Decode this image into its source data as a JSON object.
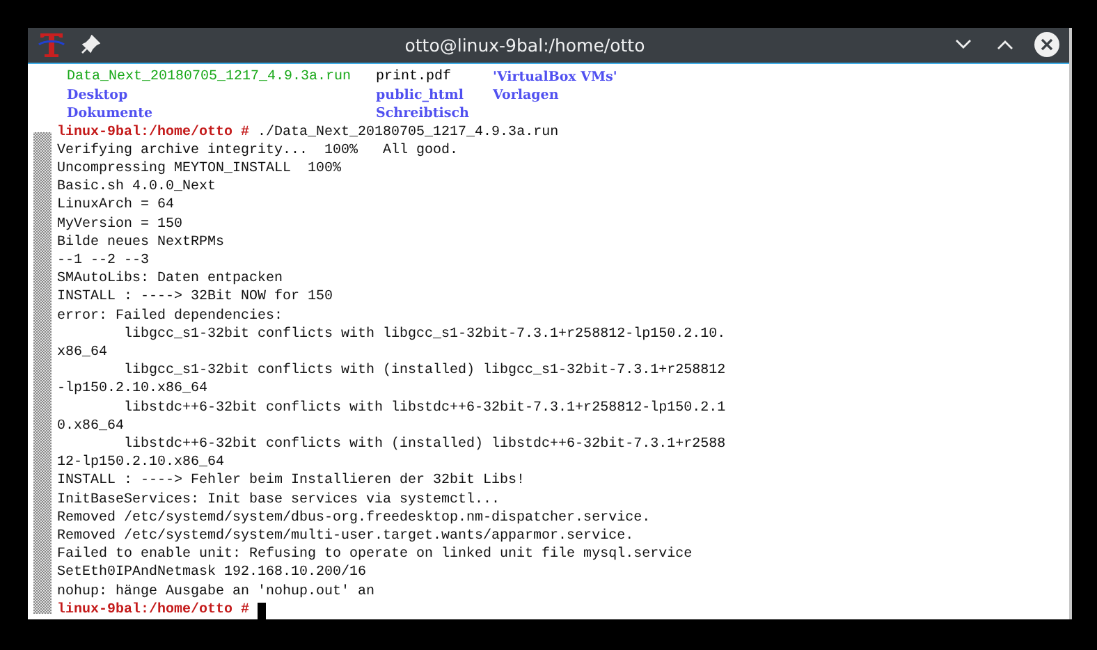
{
  "window": {
    "title": "otto@linux-9bal:/home/otto"
  },
  "listing": [
    [
      {
        "name": "Data_Next_20180705_1217_4.9.3a.run",
        "kind": "executable"
      },
      {
        "name": "print.pdf",
        "kind": "file"
      },
      {
        "name": "'VirtualBox VMs'",
        "kind": "directory"
      }
    ],
    [
      {
        "name": "Desktop",
        "kind": "directory"
      },
      {
        "name": "public_html",
        "kind": "directory"
      },
      {
        "name": "Vorlagen",
        "kind": "directory"
      }
    ],
    [
      {
        "name": "Dokumente",
        "kind": "directory"
      },
      {
        "name": "Schreibtisch",
        "kind": "directory"
      }
    ]
  ],
  "lines": [
    {
      "kind": "prompt",
      "prompt": "linux-9bal:/home/otto #",
      "command": "./Data_Next_20180705_1217_4.9.3a.run",
      "cursor": false
    },
    {
      "kind": "output",
      "text": "Verifying archive integrity...  100%   All good."
    },
    {
      "kind": "output",
      "text": "Uncompressing MEYTON_INSTALL  100%"
    },
    {
      "kind": "output",
      "text": "Basic.sh 4.0.0_Next"
    },
    {
      "kind": "output",
      "text": "LinuxArch = 64"
    },
    {
      "kind": "output",
      "text": "MyVersion = 150"
    },
    {
      "kind": "output",
      "text": "Bilde neues NextRPMs"
    },
    {
      "kind": "output",
      "text": "--1 --2 --3"
    },
    {
      "kind": "output",
      "text": "SMAutoLibs: Daten entpacken"
    },
    {
      "kind": "output",
      "text": "INSTALL : ----> 32Bit NOW for 150"
    },
    {
      "kind": "output",
      "text": "error: Failed dependencies:"
    },
    {
      "kind": "output",
      "text": "        libgcc_s1-32bit conflicts with libgcc_s1-32bit-7.3.1+r258812-lp150.2.10."
    },
    {
      "kind": "output",
      "text": "x86_64"
    },
    {
      "kind": "output",
      "text": "        libgcc_s1-32bit conflicts with (installed) libgcc_s1-32bit-7.3.1+r258812"
    },
    {
      "kind": "output",
      "text": "-lp150.2.10.x86_64"
    },
    {
      "kind": "output",
      "text": "        libstdc++6-32bit conflicts with libstdc++6-32bit-7.3.1+r258812-lp150.2.1"
    },
    {
      "kind": "output",
      "text": "0.x86_64"
    },
    {
      "kind": "output",
      "text": "        libstdc++6-32bit conflicts with (installed) libstdc++6-32bit-7.3.1+r2588"
    },
    {
      "kind": "output",
      "text": "12-lp150.2.10.x86_64"
    },
    {
      "kind": "output",
      "text": "INSTALL : ----> Fehler beim Installieren der 32bit Libs!"
    },
    {
      "kind": "output",
      "text": "InitBaseServices: Init base services via systemctl..."
    },
    {
      "kind": "output",
      "text": "Removed /etc/systemd/system/dbus-org.freedesktop.nm-dispatcher.service."
    },
    {
      "kind": "output",
      "text": "Removed /etc/systemd/system/multi-user.target.wants/apparmor.service."
    },
    {
      "kind": "output",
      "text": "Failed to enable unit: Refusing to operate on linked unit file mysql.service"
    },
    {
      "kind": "output",
      "text": "SetEth0IPAndNetmask 192.168.10.200/16"
    },
    {
      "kind": "output",
      "text": "nohup: hänge Ausgabe an 'nohup.out' an"
    },
    {
      "kind": "prompt",
      "prompt": "linux-9bal:/home/otto #",
      "cursor": true
    }
  ]
}
